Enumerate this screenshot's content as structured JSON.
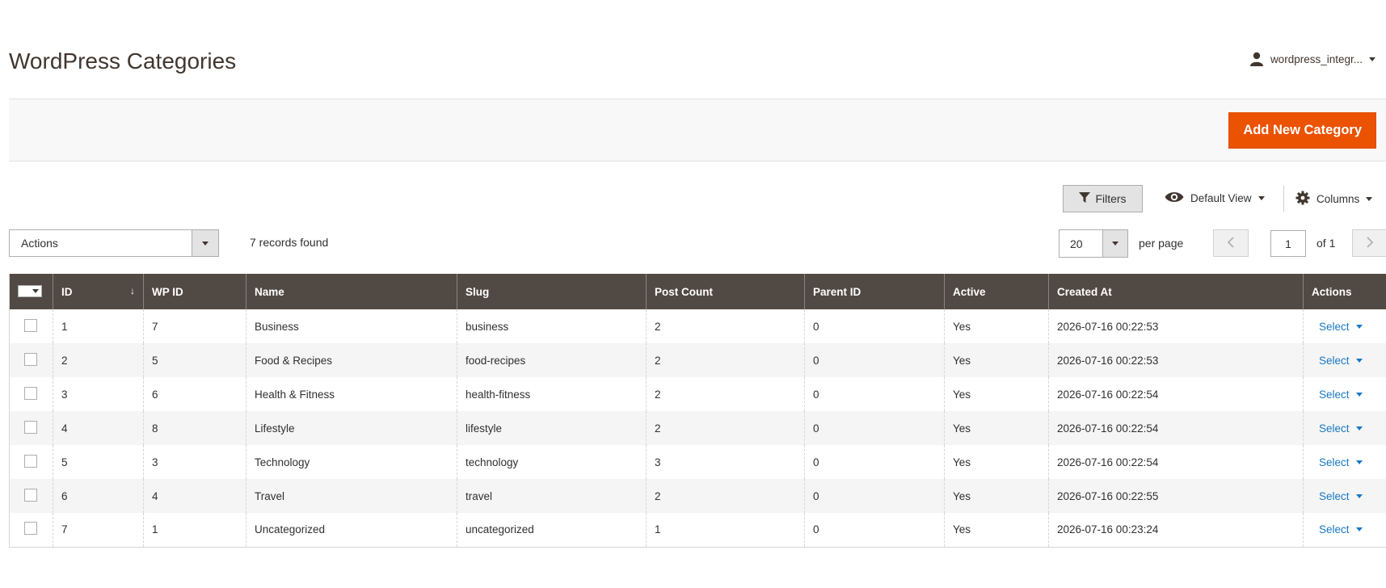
{
  "header": {
    "page_title": "WordPress Categories",
    "user_name": "wordpress_integr..."
  },
  "action_bar": {
    "add_button_label": "Add New Category",
    "accent_color": "#eb5202"
  },
  "grid_controls": {
    "filters_label": "Filters",
    "view_label": "Default View",
    "columns_label": "Columns",
    "actions_label": "Actions",
    "records_found": "7 records found",
    "per_page_value": "20",
    "per_page_label": "per page",
    "current_page": "1",
    "page_of": "of 1"
  },
  "table": {
    "header_color": "#514943",
    "columns": [
      "ID",
      "WP ID",
      "Name",
      "Slug",
      "Post Count",
      "Parent ID",
      "Active",
      "Created At",
      "Actions"
    ],
    "sort_indicator": "↓",
    "row_action_label": "Select",
    "rows": [
      {
        "id": "1",
        "wp_id": "7",
        "name": "Business",
        "slug": "business",
        "post_count": "2",
        "parent_id": "0",
        "active": "Yes",
        "created_at": "2026-07-16 00:22:53"
      },
      {
        "id": "2",
        "wp_id": "5",
        "name": "Food & Recipes",
        "slug": "food-recipes",
        "post_count": "2",
        "parent_id": "0",
        "active": "Yes",
        "created_at": "2026-07-16 00:22:53"
      },
      {
        "id": "3",
        "wp_id": "6",
        "name": "Health & Fitness",
        "slug": "health-fitness",
        "post_count": "2",
        "parent_id": "0",
        "active": "Yes",
        "created_at": "2026-07-16 00:22:54"
      },
      {
        "id": "4",
        "wp_id": "8",
        "name": "Lifestyle",
        "slug": "lifestyle",
        "post_count": "2",
        "parent_id": "0",
        "active": "Yes",
        "created_at": "2026-07-16 00:22:54"
      },
      {
        "id": "5",
        "wp_id": "3",
        "name": "Technology",
        "slug": "technology",
        "post_count": "3",
        "parent_id": "0",
        "active": "Yes",
        "created_at": "2026-07-16 00:22:54"
      },
      {
        "id": "6",
        "wp_id": "4",
        "name": "Travel",
        "slug": "travel",
        "post_count": "2",
        "parent_id": "0",
        "active": "Yes",
        "created_at": "2026-07-16 00:22:55"
      },
      {
        "id": "7",
        "wp_id": "1",
        "name": "Uncategorized",
        "slug": "uncategorized",
        "post_count": "1",
        "parent_id": "0",
        "active": "Yes",
        "created_at": "2026-07-16 00:23:24"
      }
    ]
  }
}
